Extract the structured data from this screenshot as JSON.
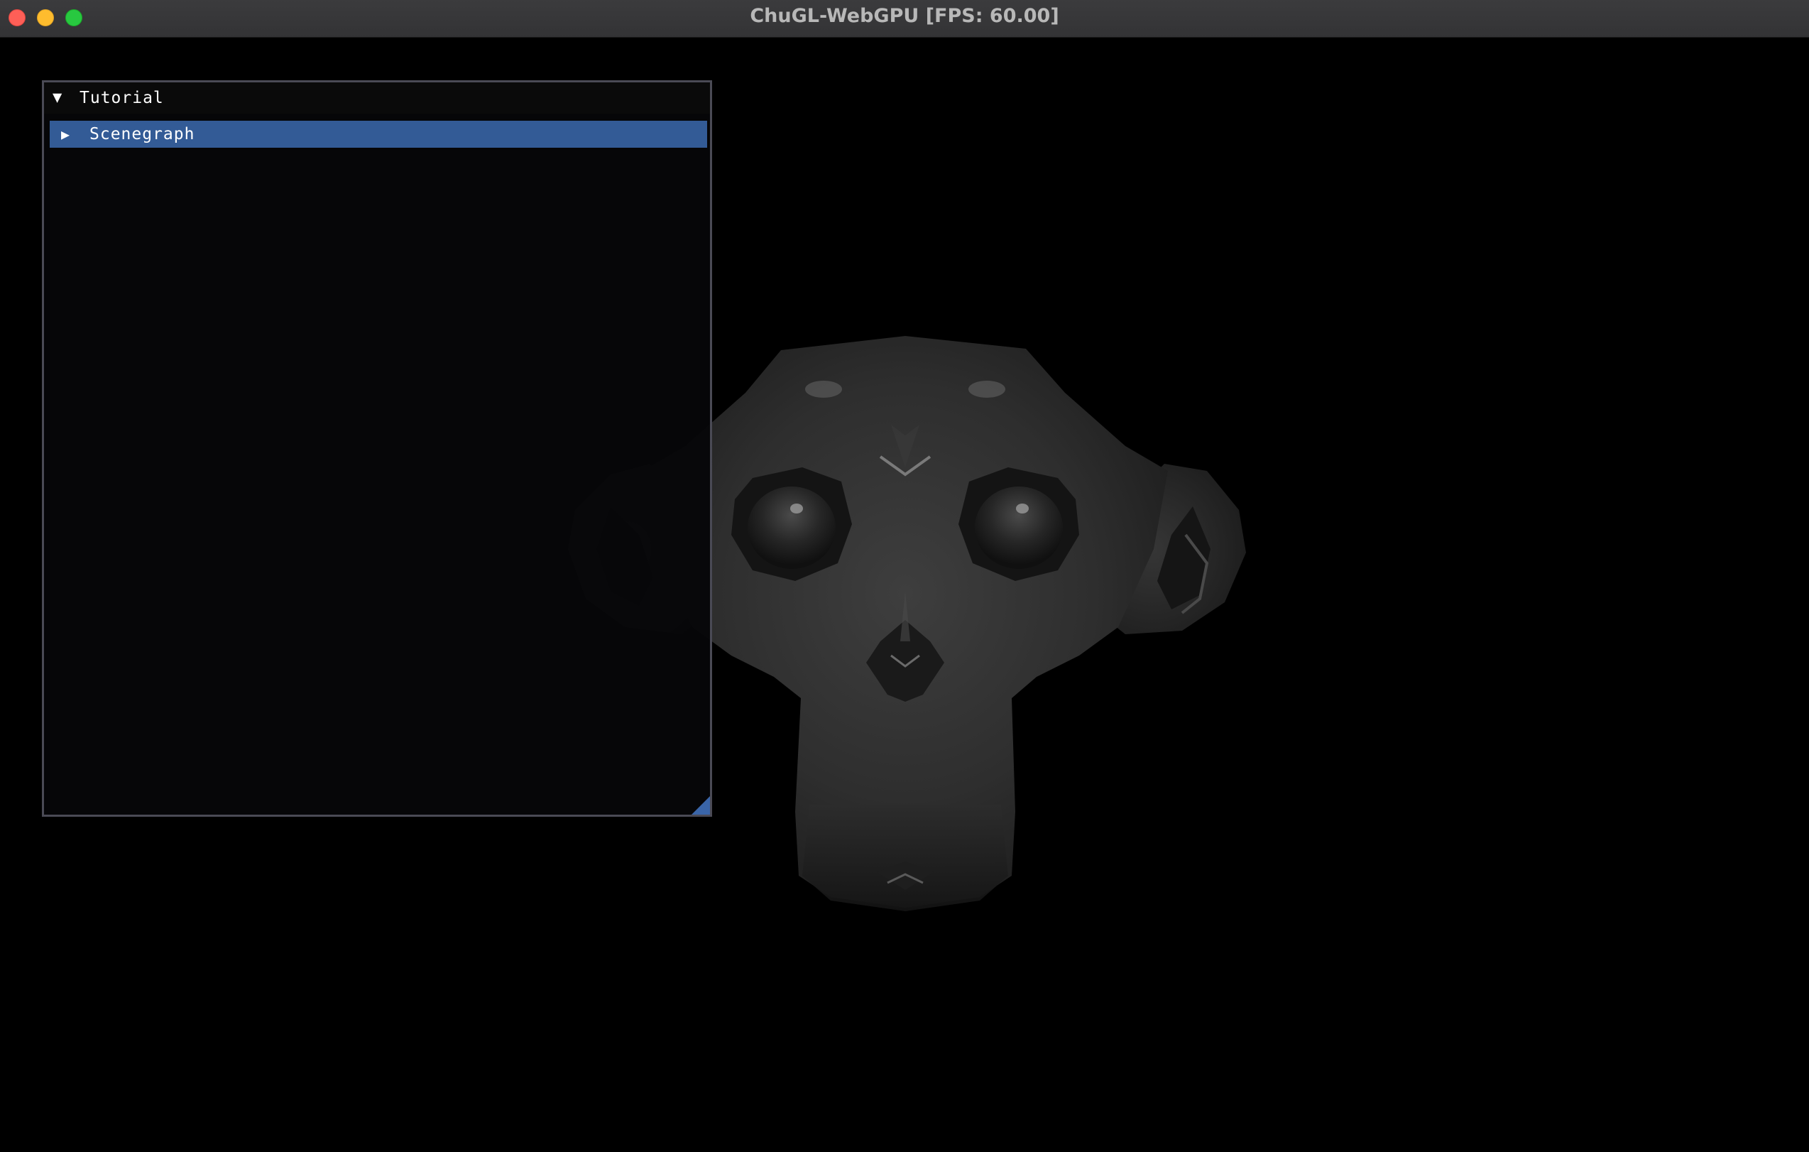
{
  "app": {
    "title": "ChuGL-WebGPU [FPS: 60.00]"
  },
  "traffic_lights": {
    "close": "close-button",
    "minimize": "minimize-button",
    "zoom": "zoom-button"
  },
  "panel": {
    "title": "Tutorial",
    "collapse_icon": "▼",
    "expanded": true,
    "items": [
      {
        "label": "Scenegraph",
        "icon": "▶",
        "expanded": false,
        "selected": true
      }
    ]
  },
  "scene": {
    "object": "monkey-head-3d-model"
  },
  "colors": {
    "titlebar": "#3b3b3d",
    "background": "#000000",
    "panel_bg": "#060608",
    "selected_item": "#335b96",
    "resize_grip": "#3a65a8"
  }
}
